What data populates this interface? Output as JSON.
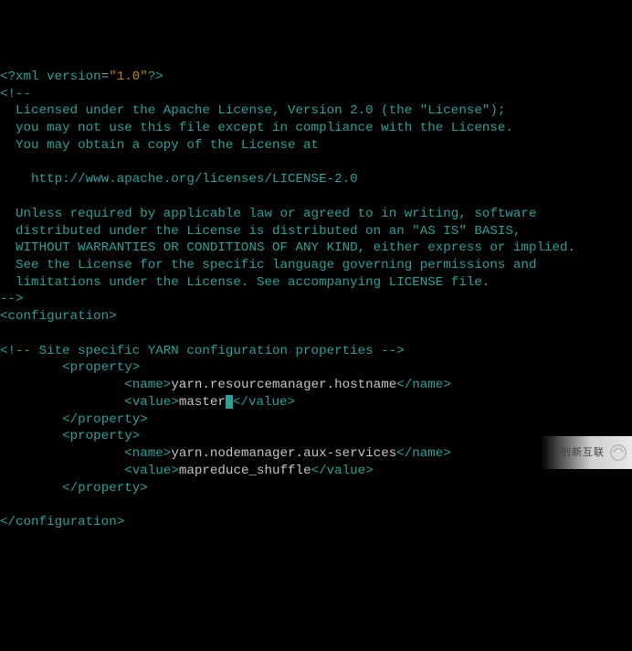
{
  "xml_decl": {
    "open": "<?",
    "name": "xml",
    "attr": "version",
    "eq": "=",
    "val": "\"1.0\"",
    "close": "?>"
  },
  "license": {
    "open": "<!--",
    "l1": "  Licensed under the Apache License, Version 2.0 (the \"License\");",
    "l2": "  you may not use this file except in compliance with the License.",
    "l3": "  You may obtain a copy of the License at",
    "blank1": "",
    "url": "    http://www.apache.org/licenses/LICENSE-2.0",
    "blank2": "",
    "l4": "  Unless required by applicable law or agreed to in writing, software",
    "l5": "  distributed under the License is distributed on an \"AS IS\" BASIS,",
    "l6": "  WITHOUT WARRANTIES OR CONDITIONS OF ANY KIND, either express or implied.",
    "l7": "  See the License for the specific language governing permissions and",
    "l8": "  limitations under the License. See accompanying LICENSE file.",
    "close": "-->"
  },
  "root_open": "<configuration>",
  "site_comment": "<!-- Site specific YARN configuration properties -->",
  "prop1": {
    "open": "<property>",
    "name_open": "<name>",
    "name_val": "yarn.resourcemanager.hostname",
    "name_close": "</name>",
    "value_open": "<value>",
    "value_val": "master",
    "value_close": "</value>",
    "close": "</property>"
  },
  "prop2": {
    "open": "<property>",
    "name_open": "<name>",
    "name_val": "yarn.nodemanager.aux-services",
    "name_close": "</name>",
    "value_open": "<value>",
    "value_val": "mapreduce_shuffle",
    "value_close": "</value>",
    "close": "</property>"
  },
  "root_close": "</configuration>",
  "prompt": "~",
  "watermark_text": "创新互联"
}
